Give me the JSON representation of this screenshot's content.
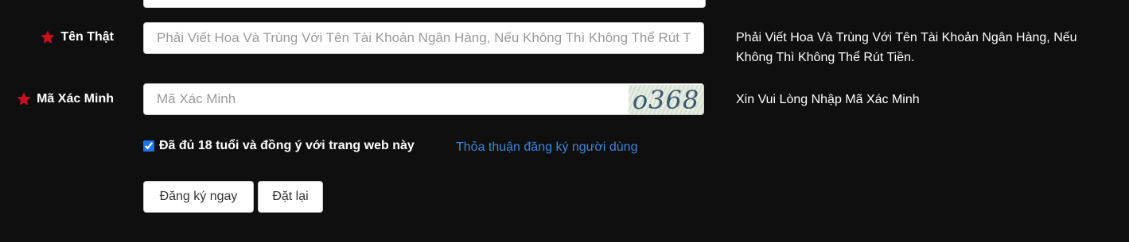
{
  "form": {
    "real_name": {
      "label": "Tên Thật",
      "placeholder": "Phải Viết Hoa Và Trùng Với Tên Tài Khoản Ngân Hàng, Nếu Không Thì Không Thể Rút Tiền.",
      "hint": "Phải Viết Hoa Và Trùng Với Tên Tài Khoản Ngân Hàng, Nếu Không Thì Không Thể Rút Tiền."
    },
    "verify_code": {
      "label": "Mã Xác Minh",
      "placeholder": "Mã Xác Minh",
      "captcha": "o368",
      "hint": "Xin Vui Lòng Nhập Mã Xác Minh"
    },
    "agree": {
      "checked": true,
      "text": "Đã đủ 18 tuổi và đồng ý với trang web này",
      "link": "Thỏa thuận đăng ký người dùng"
    },
    "buttons": {
      "register": "Đăng ký ngay",
      "reset": "Đặt lại"
    }
  },
  "colors": {
    "background": "#0f0f10",
    "required_star": "#c8101e",
    "link": "#3b86d8",
    "text": "#ffffff"
  },
  "icons": {
    "required": "star-icon"
  }
}
